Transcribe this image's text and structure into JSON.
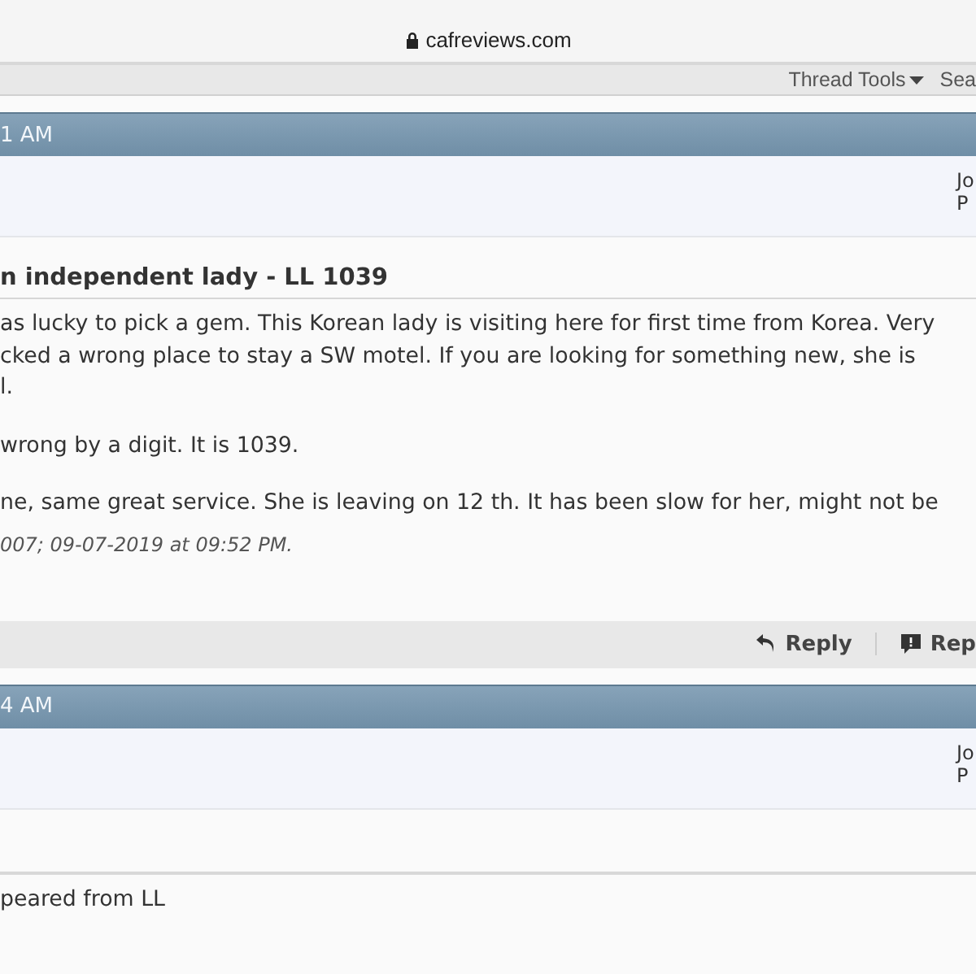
{
  "browser": {
    "url": "cafreviews.com"
  },
  "toolbar": {
    "items": [
      {
        "label": "Thread Tools",
        "kind": "menu"
      },
      {
        "label": "Sea",
        "kind": "link"
      }
    ]
  },
  "posts": [
    {
      "time": "1 AM",
      "user_lines": [
        "Jo",
        "P"
      ],
      "title": "n independent lady - LL 1039",
      "paragraphs": [
        [
          "as lucky to pick a gem. This Korean lady is visiting here for first time from Korea. Very",
          "cked a wrong place to stay a SW motel. If you are looking for something new, she is",
          "l."
        ],
        [
          "wrong by a digit. It is 1039."
        ],
        [
          "ne, same great service. She is leaving on 12 th. It has been slow for her, might not be"
        ]
      ],
      "edit_note": "007; 09-07-2019 at 09:52 PM.",
      "actions": [
        {
          "label": "Reply",
          "kind": "reply"
        },
        {
          "label": "Rep",
          "kind": "report"
        }
      ]
    },
    {
      "time": "4 AM",
      "user_lines": [
        "Jo",
        "P"
      ],
      "paragraphs": [
        [
          "peared from LL"
        ]
      ]
    }
  ]
}
